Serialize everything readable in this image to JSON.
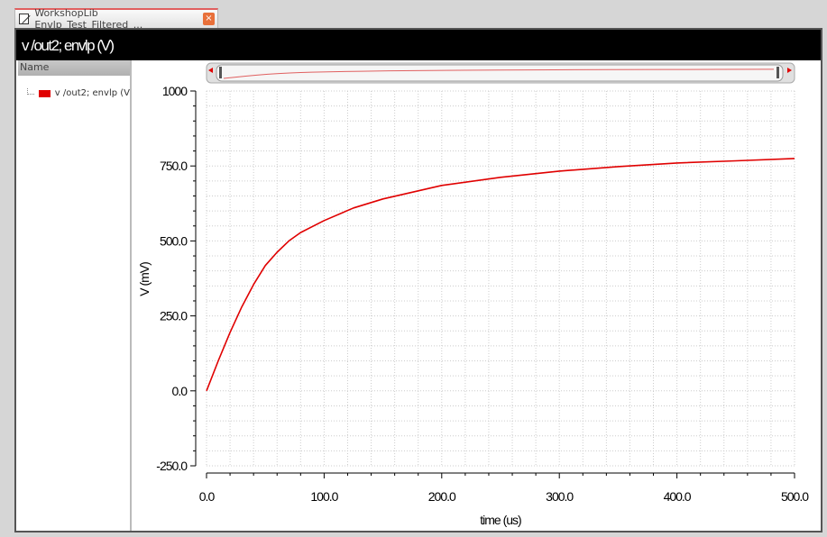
{
  "tab": {
    "title": "WorkshopLib Envlp_Test_Filtered_...",
    "close_label": "×"
  },
  "header": {
    "title": "v /out2; envlp (V)"
  },
  "legend_panel": {
    "column_header": "Name",
    "items": [
      {
        "label": "v /out2; envlp (V",
        "color": "#e00000"
      }
    ]
  },
  "chart_data": {
    "type": "line",
    "xlabel": "time (us)",
    "ylabel": "V (mV)",
    "xlim": [
      0,
      500
    ],
    "ylim": [
      -250,
      1000
    ],
    "xticks": [
      "0.0",
      "100.0",
      "200.0",
      "300.0",
      "400.0",
      "500.0"
    ],
    "yticks": [
      "1000",
      "750.0",
      "500.0",
      "250.0",
      "0.0",
      "-250.0"
    ],
    "grid": true,
    "series": [
      {
        "name": "v /out2; envlp (V)",
        "color": "#e00000",
        "x": [
          0,
          10,
          20,
          30,
          40,
          50,
          60,
          70,
          80,
          100,
          125,
          150,
          200,
          250,
          300,
          350,
          400,
          450,
          500
        ],
        "y": [
          0,
          100,
          195,
          280,
          355,
          418,
          462,
          500,
          528,
          568,
          610,
          640,
          685,
          712,
          733,
          748,
          760,
          767,
          775
        ]
      }
    ]
  }
}
